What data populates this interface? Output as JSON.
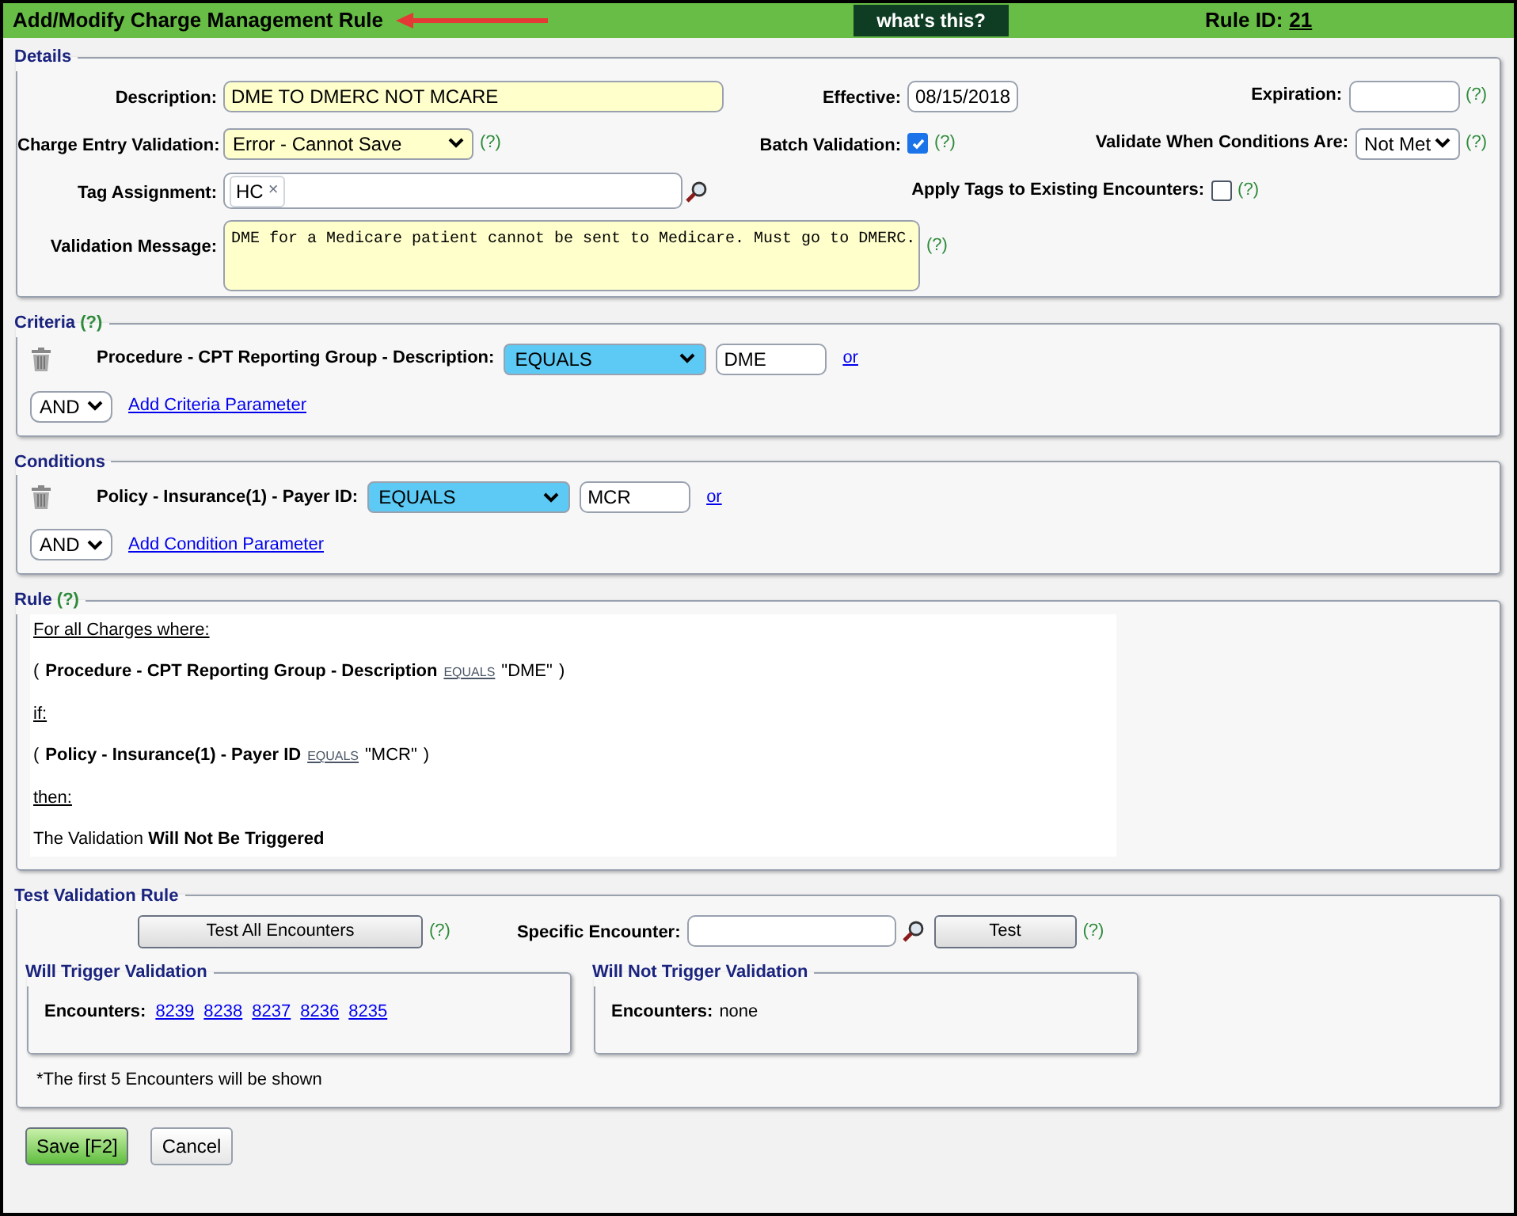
{
  "header": {
    "title": "Add/Modify Charge Management Rule",
    "whats_this": "what's this?",
    "rule_id_label": "Rule ID:",
    "rule_id": "21"
  },
  "details": {
    "legend": "Details",
    "description": {
      "label": "Description:",
      "value": "DME TO DMERC NOT MCARE"
    },
    "effective": {
      "label": "Effective:",
      "value": "08/15/2018"
    },
    "expiration": {
      "label": "Expiration:",
      "help": "(?)"
    },
    "charge_entry_validation": {
      "label": "Charge Entry Validation:",
      "value": "Error - Cannot Save",
      "help": "(?)"
    },
    "batch_validation": {
      "label": "Batch Validation:",
      "checked": true,
      "help": "(?)"
    },
    "validate_when": {
      "label": "Validate When Conditions Are:",
      "value": "Not Met",
      "help": "(?)"
    },
    "tag_assignment": {
      "label": "Tag Assignment:",
      "tags": [
        "HC"
      ],
      "remove": "×"
    },
    "apply_tags": {
      "label": "Apply Tags to Existing Encounters:",
      "checked": false,
      "help": "(?)"
    },
    "validation_message": {
      "label": "Validation Message:",
      "value": "DME for a Medicare patient cannot be sent to Medicare. Must go to DMERC.",
      "help": "(?)"
    }
  },
  "criteria": {
    "legend": "Criteria",
    "help": "(?)",
    "rows": [
      {
        "label": "Procedure - CPT Reporting Group - Description:",
        "operator": "EQUALS",
        "value": "DME",
        "or": "or"
      }
    ],
    "joiner": "AND",
    "add_link": "Add Criteria Parameter"
  },
  "conditions": {
    "legend": "Conditions",
    "rows": [
      {
        "label": "Policy - Insurance(1) - Payer ID:",
        "operator": "EQUALS",
        "value": "MCR",
        "or": "or"
      }
    ],
    "joiner": "AND",
    "add_link": "Add Condition Parameter"
  },
  "rule": {
    "legend": "Rule",
    "help": "(?)",
    "lines": [
      {
        "kind": "heading",
        "text": "For all Charges where:"
      },
      {
        "kind": "clause",
        "open": "(",
        "field": "Procedure - CPT Reporting Group - Description",
        "operator": "EQUALS",
        "value": "\"DME\"",
        "close": ")"
      },
      {
        "kind": "heading",
        "text": "if:"
      },
      {
        "kind": "clause",
        "open": "(",
        "field": "Policy - Insurance(1) - Payer ID",
        "operator": "EQUALS",
        "value": "\"MCR\"",
        "close": ")"
      },
      {
        "kind": "heading",
        "text": "then:"
      },
      {
        "kind": "result",
        "text": "The Validation **Will Not Be Triggered**"
      }
    ]
  },
  "test": {
    "legend": "Test Validation Rule",
    "test_all": "Test All Encounters",
    "test_all_help": "(?)",
    "specific_label": "Specific Encounter:",
    "test_button": "Test",
    "test_help": "(?)",
    "will_trigger": {
      "legend": "Will Trigger Validation",
      "label": "Encounters:",
      "links": [
        "8239",
        "8238",
        "8237",
        "8236",
        "8235"
      ]
    },
    "will_not_trigger": {
      "legend": "Will Not Trigger Validation",
      "label": "Encounters:",
      "value": "none"
    },
    "note": "*The first 5 Encounters will be shown"
  },
  "buttons": {
    "save": "Save [F2]",
    "cancel": "Cancel"
  }
}
